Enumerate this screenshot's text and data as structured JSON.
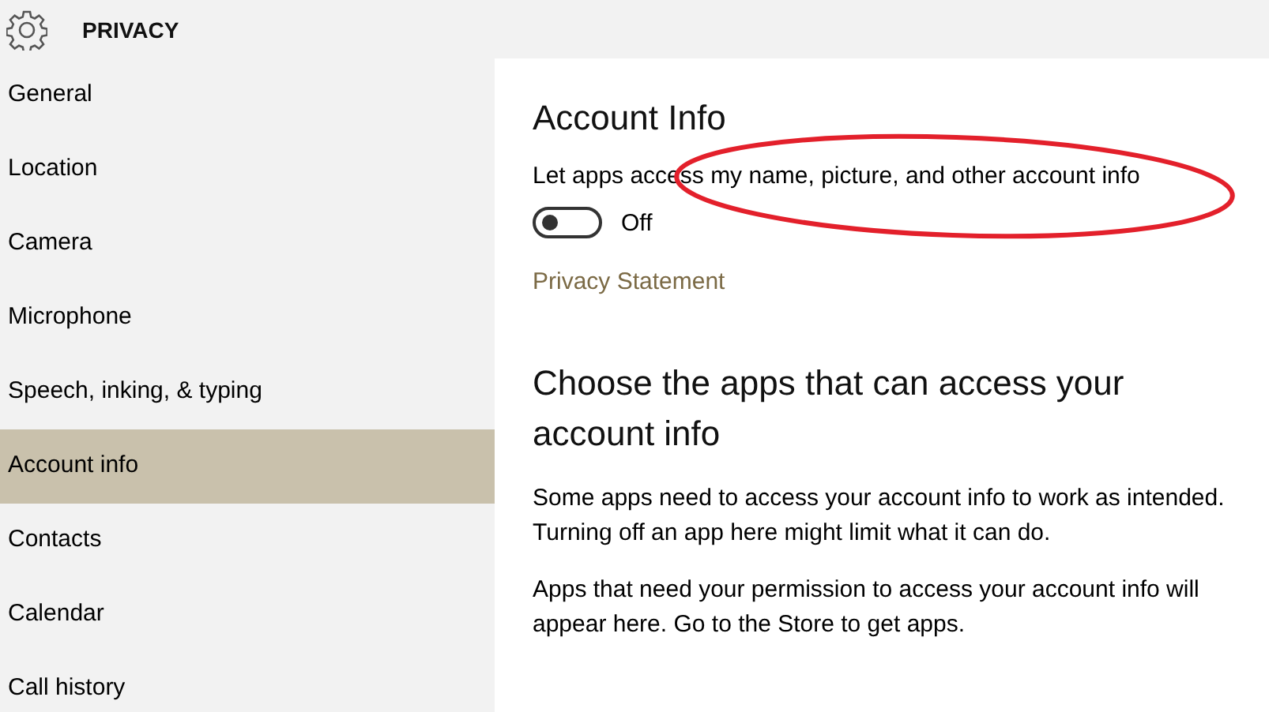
{
  "header": {
    "title": "PRIVACY"
  },
  "sidebar": {
    "items": [
      {
        "label": "General",
        "selected": false
      },
      {
        "label": "Location",
        "selected": false
      },
      {
        "label": "Camera",
        "selected": false
      },
      {
        "label": "Microphone",
        "selected": false
      },
      {
        "label": "Speech, inking, & typing",
        "selected": false
      },
      {
        "label": "Account info",
        "selected": true
      },
      {
        "label": "Contacts",
        "selected": false
      },
      {
        "label": "Calendar",
        "selected": false
      },
      {
        "label": "Call history",
        "selected": false
      }
    ]
  },
  "content": {
    "title": "Account Info",
    "setting": {
      "label": "Let apps access my name, picture, and other account info",
      "on": false,
      "state_label": "Off"
    },
    "link": "Privacy Statement",
    "section_title": "Choose the apps that can access your account info",
    "paragraphs": [
      "Some apps need to access your account info to work as intended. Turning off an app here might limit what it can do.",
      "Apps that need your permission to access your account info will appear here. Go to the Store to get apps."
    ]
  },
  "annotation": {
    "kind": "ellipse",
    "color": "#e3202b"
  }
}
